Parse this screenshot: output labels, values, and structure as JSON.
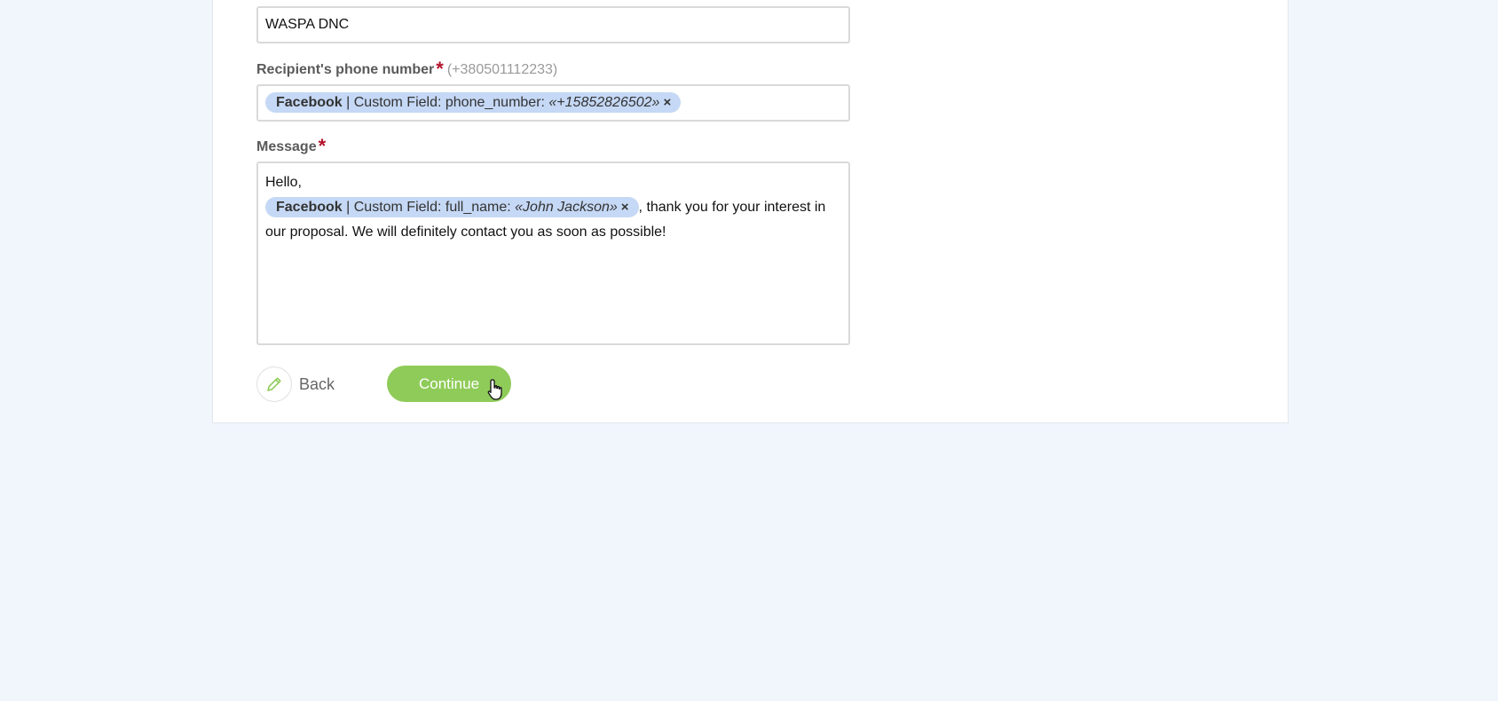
{
  "sender_field": {
    "value": "WASPA DNC"
  },
  "phone_field": {
    "label": "Recipient's phone number",
    "required_mark": "*",
    "hint": "(+380501112233)",
    "tag": {
      "source": "Facebook",
      "field": " | Custom Field: phone_number: ",
      "value": "«+15852826502»",
      "remove": "×"
    }
  },
  "message_field": {
    "label": "Message",
    "required_mark": "*",
    "greeting": "Hello,",
    "tag": {
      "source": "Facebook",
      "field": " | Custom Field: full_name: ",
      "value": "«John Jackson»",
      "remove": "×"
    },
    "text_after": ", thank you for your interest in our proposal. We will definitely contact you as soon as possible!"
  },
  "buttons": {
    "back_label": "Back",
    "continue_label": "Continue"
  },
  "colors": {
    "accent_green": "#8fcb59",
    "tag_bg": "#c5d8f5",
    "required_red": "#b3132b",
    "page_bg": "#f1f6fd"
  },
  "icons": {
    "back": "pencil-icon",
    "cursor": "hand-pointer-icon"
  }
}
